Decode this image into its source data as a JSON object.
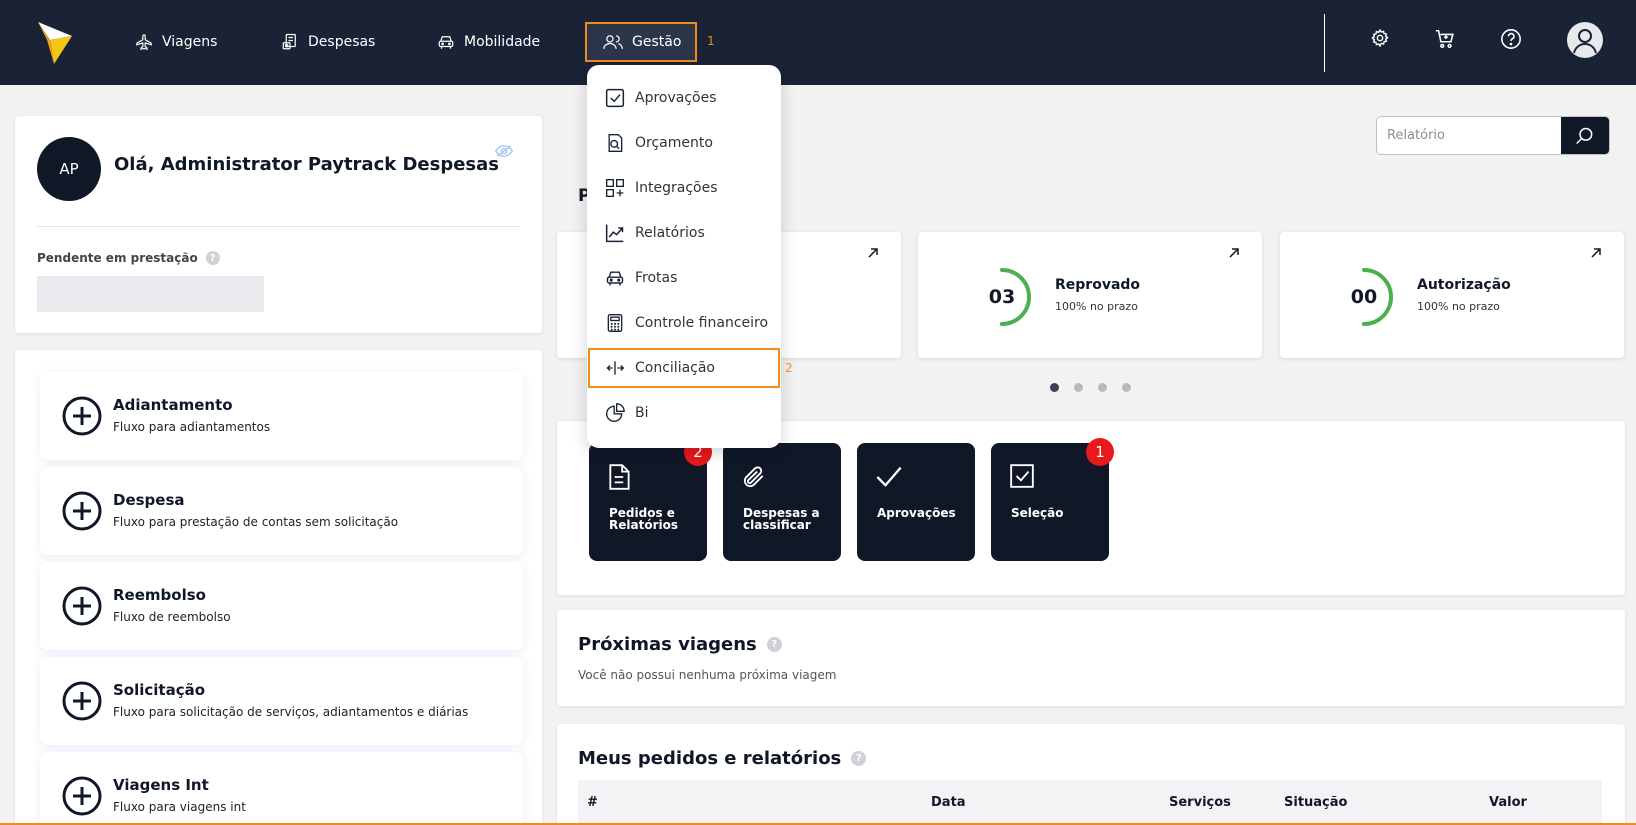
{
  "nav": {
    "items": [
      {
        "label": "Viagens",
        "icon": "plane-icon"
      },
      {
        "label": "Despesas",
        "icon": "receipt-icon"
      },
      {
        "label": "Mobilidade",
        "icon": "car-icon"
      },
      {
        "label": "Gestão",
        "icon": "users-icon"
      }
    ],
    "active_marker": "1",
    "right_icons": [
      "gear-icon",
      "cart-icon",
      "help-icon",
      "user-avatar-icon"
    ]
  },
  "dropdown": {
    "items": [
      {
        "label": "Aprovações",
        "icon": "check-square-icon"
      },
      {
        "label": "Orçamento",
        "icon": "budget-icon"
      },
      {
        "label": "Integrações",
        "icon": "grid-plus-icon"
      },
      {
        "label": "Relatórios",
        "icon": "trend-chart-icon"
      },
      {
        "label": "Frotas",
        "icon": "car-icon"
      },
      {
        "label": "Controle financeiro",
        "icon": "calculator-icon"
      },
      {
        "label": "Conciliação",
        "icon": "arrows-split-icon"
      },
      {
        "label": "Bi",
        "icon": "pie-chart-icon"
      }
    ],
    "highlight_marker": "2"
  },
  "profile": {
    "initials": "AP",
    "greeting": "Olá, Administrator Paytrack Despesas",
    "pending_label": "Pendente em prestação",
    "help": "?"
  },
  "flows": [
    {
      "title": "Adiantamento",
      "desc": "Fluxo para adiantamentos"
    },
    {
      "title": "Despesa",
      "desc": "Fluxo para prestação de contas sem solicitação"
    },
    {
      "title": "Reembolso",
      "desc": "Fluxo de reembolso"
    },
    {
      "title": "Solicitação",
      "desc": "Fluxo para solicitação de serviços, adiantamentos e diárias"
    },
    {
      "title": "Viagens Int",
      "desc": "Fluxo para viagens int"
    }
  ],
  "search": {
    "placeholder": "Relatório"
  },
  "section_letter": "P",
  "stats": [
    {
      "value": "03",
      "title": "Reprovado",
      "sub": "100% no prazo",
      "progress": 0.5
    },
    {
      "value": "00",
      "title": "Autorização",
      "sub": "100% no prazo",
      "progress": 0.5
    }
  ],
  "carousel": {
    "count": 4,
    "active": 0
  },
  "shortcuts": [
    {
      "label": "Pedidos e Relatórios",
      "icon": "document-icon",
      "badge": "2"
    },
    {
      "label": "Despesas a classificar",
      "icon": "paperclip-icon",
      "badge": ""
    },
    {
      "label": "Aprovações",
      "icon": "checkmark-icon",
      "badge": ""
    },
    {
      "label": "Seleção",
      "icon": "check-square-icon",
      "badge": "1"
    }
  ],
  "trips": {
    "title": "Próximas viagens",
    "empty": "Você não possui nenhuma próxima viagem",
    "help": "?"
  },
  "orders": {
    "title": "Meus pedidos e relatórios",
    "help": "?",
    "columns": [
      "#",
      "Data",
      "Serviços",
      "Situação",
      "Valor"
    ]
  },
  "colors": {
    "navbar": "#1a2336",
    "highlight": "#f28a1d",
    "dark_tile": "#101828",
    "ring": "#4caf50",
    "badge": "#e7191c"
  }
}
